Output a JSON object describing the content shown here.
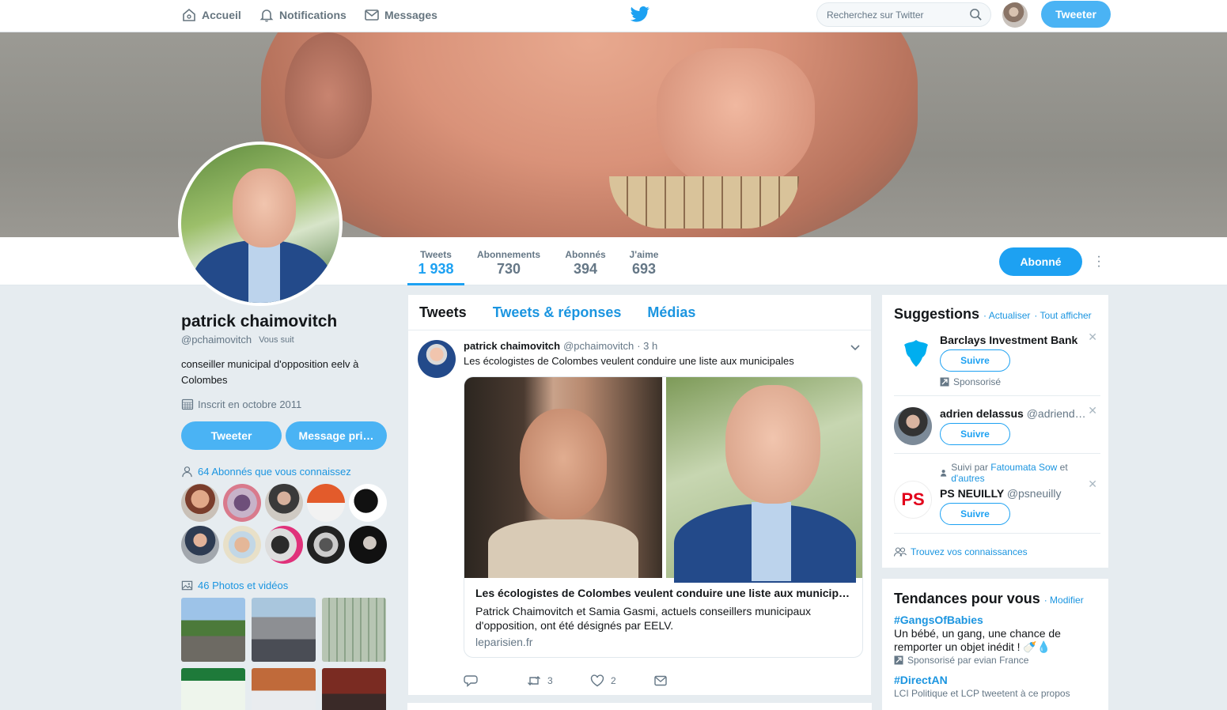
{
  "nav": {
    "home": "Accueil",
    "notifications": "Notifications",
    "messages": "Messages",
    "search_placeholder": "Recherchez sur Twitter",
    "tweet_button": "Tweeter"
  },
  "profile": {
    "name": "patrick chaimovitch",
    "handle": "@pchaimovitch",
    "follows_you": "Vous suit",
    "bio": "conseiller municipal d'opposition eelv à Colombes",
    "joined": "Inscrit en octobre 2011",
    "tweet_button": "Tweeter",
    "message_button": "Message pri…",
    "known_followers": "64 Abonnés que vous connaissez",
    "photos_videos": "46 Photos et vidéos",
    "follow_state": "Abonné",
    "stats": [
      {
        "label": "Tweets",
        "value": "1 938"
      },
      {
        "label": "Abonnements",
        "value": "730"
      },
      {
        "label": "Abonnés",
        "value": "394"
      },
      {
        "label": "J'aime",
        "value": "693"
      }
    ]
  },
  "timeline": {
    "tabs": [
      "Tweets",
      "Tweets & réponses",
      "Médias"
    ],
    "tweet": {
      "name": "patrick chaimovitch",
      "handle": "@pchaimovitch",
      "time": "· 3 h",
      "text": "Les écologistes de Colombes veulent conduire une liste aux municipales",
      "card_title": "Les écologistes de Colombes veulent conduire une liste aux municip…",
      "card_desc": "Patrick Chaimovitch et Samia Gasmi, actuels conseillers municipaux d'opposition, ont été désignés par EELV.",
      "card_domain": "leparisien.fr",
      "retweets": "3",
      "likes": "2"
    }
  },
  "suggestions": {
    "title": "Suggestions",
    "refresh": "· Actualiser",
    "show_all": "· Tout afficher",
    "follow_label": "Suivre",
    "items": [
      {
        "name": "Barclays Investment Bank",
        "handle": "",
        "note": "Sponsorisé"
      },
      {
        "name": "adrien delassus",
        "handle": "@adriend…",
        "note": ""
      },
      {
        "name": "PS NEUILLY",
        "handle": "@psneuilly",
        "note_prefix": "Suivi par",
        "note_link1": "Fatoumata Sow",
        "note_mid": "et",
        "note_link2": "d'autres"
      }
    ],
    "find_people": "Trouvez vos connaissances"
  },
  "trends": {
    "title": "Tendances pour vous",
    "modify": "· Modifier",
    "items": [
      {
        "tag": "#GangsOfBabies",
        "desc": "Un bébé, un gang, une chance de remporter un objet inédit ! 🍼💧",
        "meta": "Sponsorisé par evian France"
      },
      {
        "tag": "#DirectAN",
        "desc": "",
        "meta": "LCI Politique et LCP tweetent à ce propos"
      }
    ]
  },
  "colors": {
    "accent": "#1da1f2",
    "link": "#1b95e0",
    "background": "#e6ecf0"
  }
}
